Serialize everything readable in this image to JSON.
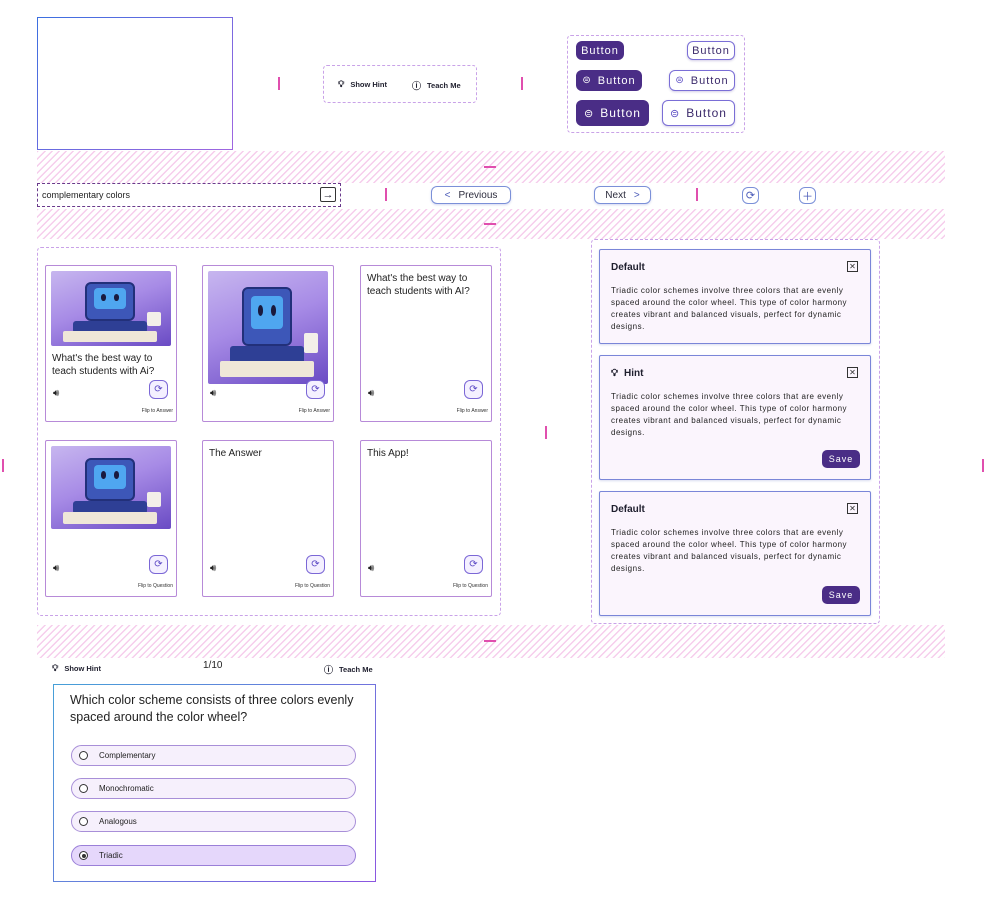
{
  "hint_teach_bar": {
    "show_hint": "Show Hint",
    "teach_me": "Teach Me"
  },
  "buttons_demo": {
    "label": "Button"
  },
  "search": {
    "value": "complementary colors"
  },
  "nav": {
    "previous": "Previous",
    "next": "Next"
  },
  "flashcards": [
    {
      "question": "What's the best way to teach students with Ai?",
      "flip_label": "Flip to Answer"
    },
    {
      "question": "",
      "flip_label": "Flip to Answer"
    },
    {
      "question": "What's the best way to teach students with AI?",
      "flip_label": "Flip to Answer"
    },
    {
      "question": "",
      "flip_label": "Flip to Question"
    },
    {
      "question": "The Answer",
      "flip_label": "Flip to Question"
    },
    {
      "question": "This App!",
      "flip_label": "Flip to Question"
    }
  ],
  "hint_cards": [
    {
      "title": "Default",
      "body": "Triadic color schemes involve three colors that are evenly spaced around the color wheel. This type of color harmony creates vibrant and balanced visuals, perfect for dynamic designs."
    },
    {
      "title": "Hint",
      "body": "Triadic color schemes involve three colors that are evenly spaced around the color wheel. This type of color harmony creates vibrant and balanced visuals, perfect for dynamic designs.",
      "save": "Save"
    },
    {
      "title": "Default",
      "body": "Triadic color schemes involve three colors that are evenly spaced around the color wheel. This type of color harmony creates vibrant and balanced visuals, perfect for dynamic designs.",
      "save": "Save"
    }
  ],
  "quiz": {
    "show_hint": "Show Hint",
    "progress": "1/10",
    "teach_me": "Teach Me",
    "question": "Which color scheme consists of three colors evenly spaced around the color wheel?",
    "options": [
      "Complementary",
      "Monochromatic",
      "Analogous",
      "Triadic"
    ],
    "selected_index": 3
  },
  "colors": {
    "accent": "#4a2d86",
    "outline": "#7b90d8",
    "hatch": "#f6cdec",
    "marker": "#e04fae"
  }
}
